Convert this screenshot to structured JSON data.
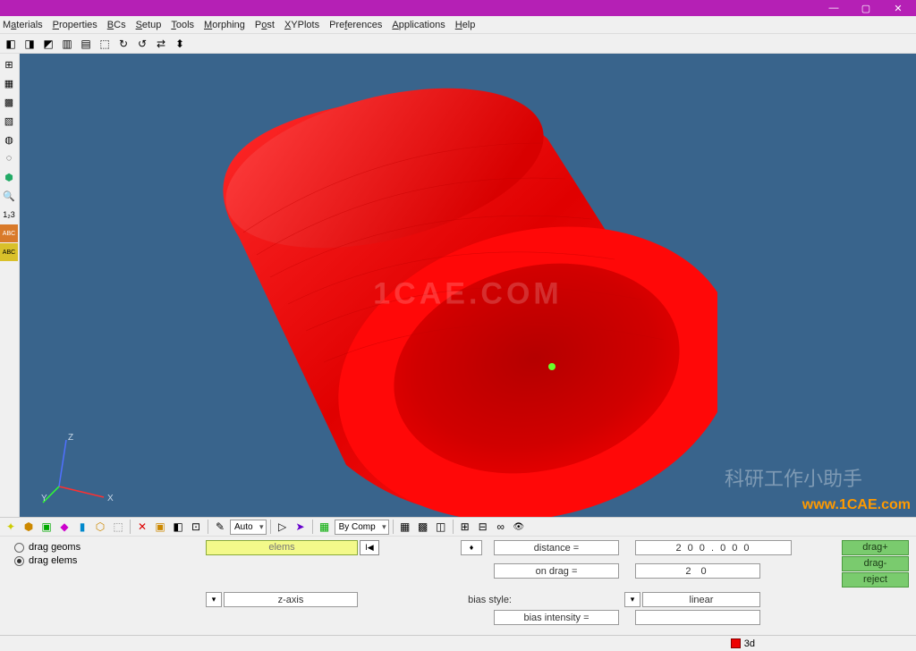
{
  "menu": {
    "items": [
      "Materials",
      "Properties",
      "BCs",
      "Setup",
      "Tools",
      "Morphing",
      "Post",
      "XYPlots",
      "Preferences",
      "Applications",
      "Help"
    ]
  },
  "toolbar2": {
    "auto": "Auto",
    "bycomp": "By Comp"
  },
  "viewport": {
    "watermark": "1CAE.COM",
    "watermark_url": "www.1CAE.com",
    "watermark_cn": "科研工作小助手",
    "axes": {
      "x": "X",
      "y": "Y",
      "z": "Z"
    }
  },
  "panel": {
    "radio1": "drag geoms",
    "radio2": "drag elems",
    "elems_btn": "elems",
    "toggle": "I◀",
    "axis_label": "z-axis",
    "distance_label": "distance =",
    "distance_value": "2 0 0 . 0 0 0",
    "ondrag_label": "on drag =",
    "ondrag_value": "2 0",
    "biasstyle_label": "bias style:",
    "biasstyle_value": "linear",
    "biasint_label": "bias intensity =",
    "biasint_value": "",
    "btn_dragp": "drag+",
    "btn_dragm": "drag-",
    "btn_reject": "reject"
  },
  "status": {
    "label": "3d"
  }
}
